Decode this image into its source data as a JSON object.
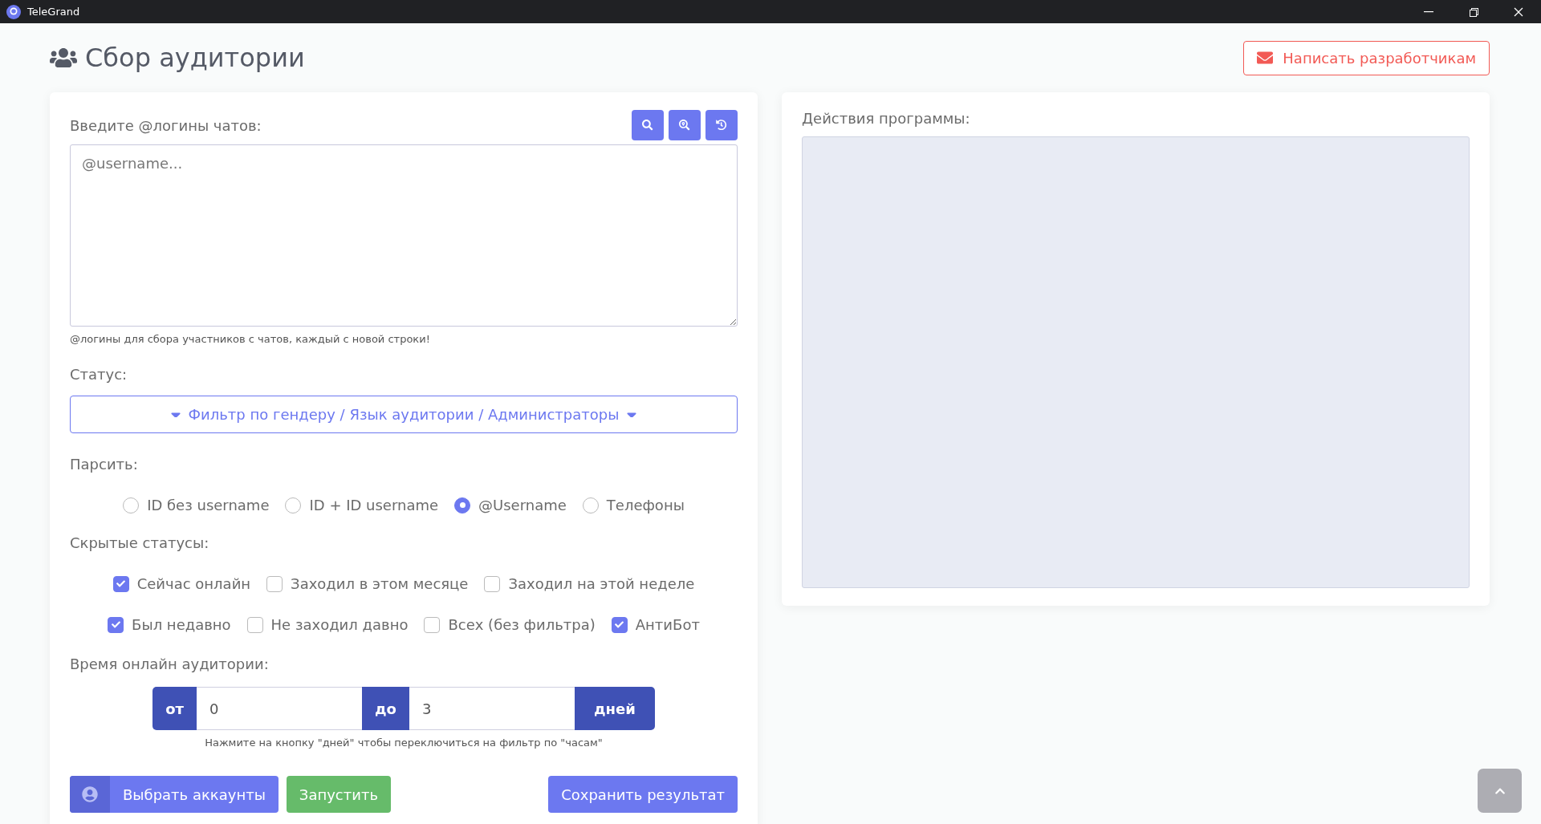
{
  "window": {
    "title": "TeleGrand"
  },
  "page": {
    "title": "Сбор аудитории",
    "contact_button": "Написать разработчикам"
  },
  "chats": {
    "label": "Введите @логины чатов:",
    "placeholder": "@username...",
    "hint": "@логины для сбора участников с чатов, каждый с новой строки!"
  },
  "status": {
    "label": "Статус:",
    "filter_button": "Фильтр по гендеру / Язык аудитории / Администраторы"
  },
  "parse": {
    "label": "Парсить:",
    "options": [
      {
        "label": "ID без username",
        "selected": false
      },
      {
        "label": "ID + ID username",
        "selected": false
      },
      {
        "label": "@Username",
        "selected": true
      },
      {
        "label": "Телефоны",
        "selected": false
      }
    ]
  },
  "hidden_statuses": {
    "label": "Скрытые статусы:",
    "rows": [
      [
        {
          "label": "Сейчас онлайн",
          "checked": true
        },
        {
          "label": "Заходил в этом месяце",
          "checked": false
        },
        {
          "label": "Заходил на этой неделе",
          "checked": false
        }
      ],
      [
        {
          "label": "Был недавно",
          "checked": true
        },
        {
          "label": "Не заходил давно",
          "checked": false
        },
        {
          "label": "Всех (без фильтра)",
          "checked": false
        },
        {
          "label": "АнтиБот",
          "checked": true
        }
      ]
    ]
  },
  "online_time": {
    "label": "Время онлайн аудитории:",
    "from_label": "от",
    "from_value": "0",
    "to_label": "до",
    "to_value": "3",
    "unit_button": "дней",
    "hint": "Нажмите на кнопку \"дней\" чтобы переключиться на фильтр по \"часам\""
  },
  "actions": {
    "select_accounts": "Выбрать аккаунты",
    "start": "Запустить",
    "save": "Сохранить результат"
  },
  "log": {
    "label": "Действия программы:"
  }
}
